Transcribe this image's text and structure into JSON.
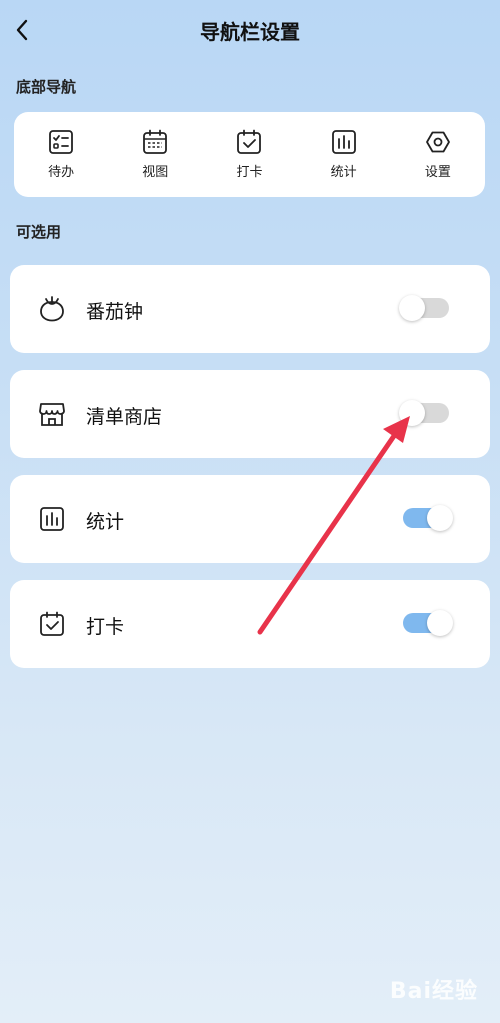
{
  "header": {
    "title": "导航栏设置"
  },
  "bottom_nav": {
    "section_title": "底部导航",
    "items": [
      {
        "label": "待办",
        "icon": "todo-icon"
      },
      {
        "label": "视图",
        "icon": "calendar-view-icon"
      },
      {
        "label": "打卡",
        "icon": "checkin-icon"
      },
      {
        "label": "统计",
        "icon": "stats-icon"
      },
      {
        "label": "设置",
        "icon": "settings-icon"
      }
    ]
  },
  "optional": {
    "section_title": "可选用",
    "items": [
      {
        "label": "番茄钟",
        "icon": "tomato-icon",
        "enabled": false
      },
      {
        "label": "清单商店",
        "icon": "store-icon",
        "enabled": false
      },
      {
        "label": "统计",
        "icon": "stats-icon",
        "enabled": true
      },
      {
        "label": "打卡",
        "icon": "checkin-icon",
        "enabled": true
      }
    ]
  },
  "colors": {
    "toggle_on": "#7fb8ee",
    "toggle_off": "#d9d9d9",
    "annotation_arrow": "#e8334a"
  },
  "watermark": {
    "text": "Bai经验"
  }
}
